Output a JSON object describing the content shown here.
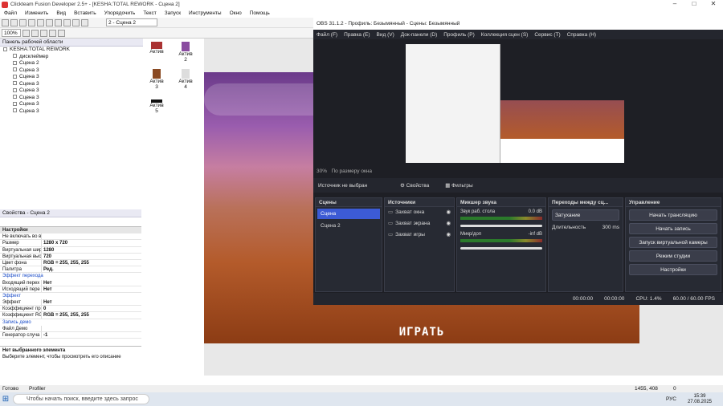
{
  "window": {
    "title": "Clickteam Fusion Developer 2.5+ - [KESHA:TOTAL REWORK - Сцена 2]"
  },
  "menu": [
    "Файл",
    "Изменить",
    "Вид",
    "Вставить",
    "Упорядочить",
    "Текст",
    "Запуск",
    "Инструменты",
    "Окно",
    "Помощь"
  ],
  "toolbar": {
    "zoom": "100%",
    "scene_select": "2 - Сцена 2"
  },
  "workspace": {
    "title": "Панель рабочей области",
    "root": "KESHA:TOTAL REWORK",
    "items": [
      "дисклеймер",
      "Сцена 2",
      "Сцена 3",
      "Сцена 3",
      "Сцена 3",
      "Сцена 3",
      "Сцена 3",
      "Сцена 3",
      "Сцена 3"
    ]
  },
  "sprites": [
    "Актив",
    "Актив 2",
    "Актив 3",
    "Актив 4",
    "Актив 5"
  ],
  "props": {
    "title": "Свойства - Сцена 2",
    "section": "Настройки",
    "rows": [
      {
        "k": "Не включать во время сборки",
        "v": ""
      },
      {
        "k": "Размер",
        "v": "1280 x 720"
      },
      {
        "k": "Виртуальная шир",
        "v": "1280"
      },
      {
        "k": "Виртуальная выс",
        "v": "720"
      },
      {
        "k": "Цвет фона",
        "v": "RGB = 255, 255, 255"
      },
      {
        "k": "Палитра",
        "v": "Ред."
      }
    ],
    "sect_transition": "Эффект перехода",
    "rows2": [
      {
        "k": "Входящий перех",
        "v": "Нет"
      },
      {
        "k": "Исходящий пере",
        "v": "Нет"
      }
    ],
    "sect_effect": "Эффект",
    "rows3": [
      {
        "k": "Эффект",
        "v": "Нет"
      },
      {
        "k": "Коэффициент пр",
        "v": "0"
      },
      {
        "k": "Коэффициент RG",
        "v": "RGB = 255, 255, 255"
      }
    ],
    "sect_demo": "Запись демо",
    "rows4": [
      {
        "k": "Файл Демо",
        "v": ""
      },
      {
        "k": "Генератор случа",
        "v": "-1"
      }
    ],
    "desc_title": "Нет выбранного элемента",
    "desc_text": "Выберите элемент, чтобы просмотреть его описание"
  },
  "scene_text": "ИГРАТЬ",
  "obs": {
    "title": "OBS 31.1.2 - Профиль: Безымянный - Сцены: Безымянный",
    "menu": [
      "Файл (F)",
      "Правка (E)",
      "Вид (V)",
      "Док-панели (D)",
      "Профиль (P)",
      "Коллекция сцен (S)",
      "Сервис (T)",
      "Справка (H)"
    ],
    "zoom": "30%",
    "zoom_mode": "По размеру окна",
    "no_source": "Источник не выбран",
    "props_btn": "Свойства",
    "filters_btn": "Фильтры",
    "scenes_title": "Сцены",
    "scenes": [
      "Сцена",
      "Сцена 2"
    ],
    "sources_title": "Источники",
    "sources": [
      "Захват окна",
      "Захват экрана",
      "Захват игры"
    ],
    "mixer_title": "Микшер звука",
    "mixer": [
      {
        "name": "Звук раб. стола",
        "db": "0.0 dB"
      },
      {
        "name": "Микр/доп",
        "db": "-inf dB"
      }
    ],
    "trans_title": "Переходы между сц...",
    "trans": "Затухание",
    "dur_label": "Длительность",
    "dur": "300 ms",
    "ctrl_title": "Управление",
    "ctrl": [
      "Начать трансляцию",
      "Начать запись",
      "Запуск виртуальной камеры",
      "Режим студии",
      "Настройки"
    ],
    "status": {
      "t1": "00:00:00",
      "t2": "00:00:00",
      "cpu": "CPU: 1.4%",
      "fps": "60.00 / 60.00 FPS"
    }
  },
  "status": {
    "ready": "Готово",
    "profiler": "Profiler",
    "coords": "1455, 408",
    "num": "0"
  },
  "taskbar": {
    "search": "Чтобы начать поиск, введите здесь запрос",
    "lang": "РУС",
    "time": "15:39",
    "date": "27.08.2025"
  }
}
